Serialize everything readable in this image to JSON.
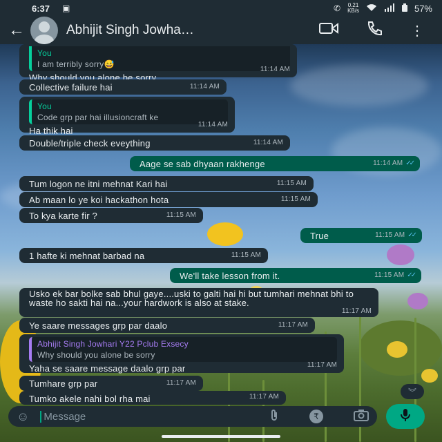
{
  "status_bar": {
    "time": "6:37",
    "speed_value": "0.21",
    "speed_unit": "KB/s",
    "battery": "57%"
  },
  "header": {
    "contact_name": "Abhijit Singh Jowha…",
    "icons": [
      "back-arrow-icon",
      "avatar",
      "video-call-icon",
      "voice-call-icon",
      "more-options-icon"
    ]
  },
  "messages": [
    {
      "dir": "in",
      "quote_author": "You",
      "quote_text": "I am terribly sorry😅",
      "text": "Why should you alone be sorry",
      "time": "11:14 AM"
    },
    {
      "dir": "in",
      "text": "Collective failure hai",
      "time": "11:14 AM"
    },
    {
      "dir": "in",
      "quote_author": "You",
      "quote_text": "Code grp par hai illusioncraft ke",
      "text": "Ha thik hai",
      "time": "11:14 AM"
    },
    {
      "dir": "in",
      "text": "Double/triple check eveything",
      "time": "11:14 AM"
    },
    {
      "dir": "out",
      "text": "Aage se sab dhyaan rakhenge",
      "time": "11:14 AM",
      "read": true
    },
    {
      "dir": "in",
      "text": "Tum logon ne itni mehnat Kari hai",
      "time": "11:15 AM"
    },
    {
      "dir": "in",
      "text": "Ab maan lo ye koi hackathon hota",
      "time": "11:15 AM"
    },
    {
      "dir": "in",
      "text": "To kya karte fir ?",
      "time": "11:15 AM"
    },
    {
      "dir": "out",
      "text": "True",
      "time": "11:15 AM",
      "read": true
    },
    {
      "dir": "in",
      "text": "1 hafte ki mehnat barbad na",
      "time": "11:15 AM"
    },
    {
      "dir": "out",
      "text": "We'll take lesson from it.",
      "time": "11:15 AM",
      "read": true
    },
    {
      "dir": "in",
      "text": "Usko ek bar bolke sab bhul gaye....uski to galti hai hi but tumhari mehnat bhi to waste ho sakti hai na...your hardwork is also at stake.",
      "time": "11:17 AM"
    },
    {
      "dir": "in",
      "text": "Ye saare messages grp par daalo",
      "time": "11:17 AM"
    },
    {
      "dir": "in",
      "quote_author": "Abhijit Singh Jowhari Y22 Pclub Exsecy",
      "quote_text": "Why should you alone be sorry",
      "text": "Yaha se saare message daalo grp par",
      "time": "11:17 AM"
    },
    {
      "dir": "in",
      "text": "Tumhare grp par",
      "time": "11:17 AM"
    },
    {
      "dir": "in",
      "text": "Tumko akele nahi bol rha mai",
      "time": "11:17 AM"
    }
  ],
  "composer": {
    "placeholder": "Message",
    "icons": [
      "emoji-icon",
      "attach-icon",
      "rupee-payment-icon",
      "camera-icon",
      "mic-icon"
    ]
  },
  "colors": {
    "incoming_bubble": "#1f2c34",
    "outgoing_bubble": "#005c4b",
    "accent": "#00a884",
    "read_ticks": "#53bdeb"
  }
}
